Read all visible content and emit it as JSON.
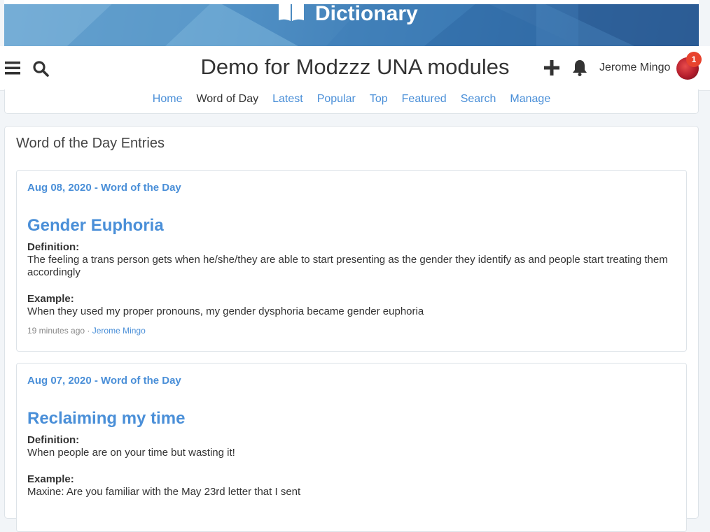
{
  "banner": {
    "title": "Dictionary",
    "icon": "book-icon"
  },
  "header": {
    "site_title": "Demo for Modzzz UNA modules",
    "menu_icon": "hamburger-icon",
    "search_icon": "search-icon",
    "add_icon": "plus-icon",
    "notification_icon": "bell-icon",
    "user_name": "Jerome Mingo",
    "notification_count": "1"
  },
  "subnav": {
    "items": [
      "Home",
      "Word of Day",
      "Latest",
      "Popular",
      "Top",
      "Featured",
      "Search",
      "Manage"
    ],
    "active": "Word of Day"
  },
  "main": {
    "title": "Word of the Day Entries",
    "entries": [
      {
        "date": "Aug 08, 2020 - Word of the Day",
        "word": "Gender Euphoria",
        "definition_label": "Definition:",
        "definition": "The feeling a trans person gets when he/she/they are able to start presenting as the gender they identify as and people start treating them accordingly",
        "example_label": "Example:",
        "example": "When they used my proper pronouns, my gender dysphoria became gender euphoria",
        "time_ago": "19 minutes ago",
        "separator": " · ",
        "author": "Jerome Mingo"
      },
      {
        "date": "Aug 07, 2020 - Word of the Day",
        "word": "Reclaiming my time",
        "definition_label": "Definition:",
        "definition": "When people are on your time but wasting it!",
        "example_label": "Example:",
        "example": "Maxine: Are you familiar with the May 23rd letter that I sent"
      }
    ]
  },
  "colors": {
    "accent": "#4a8fd8",
    "badge": "#e8432e",
    "banner": "#3b78b2"
  }
}
